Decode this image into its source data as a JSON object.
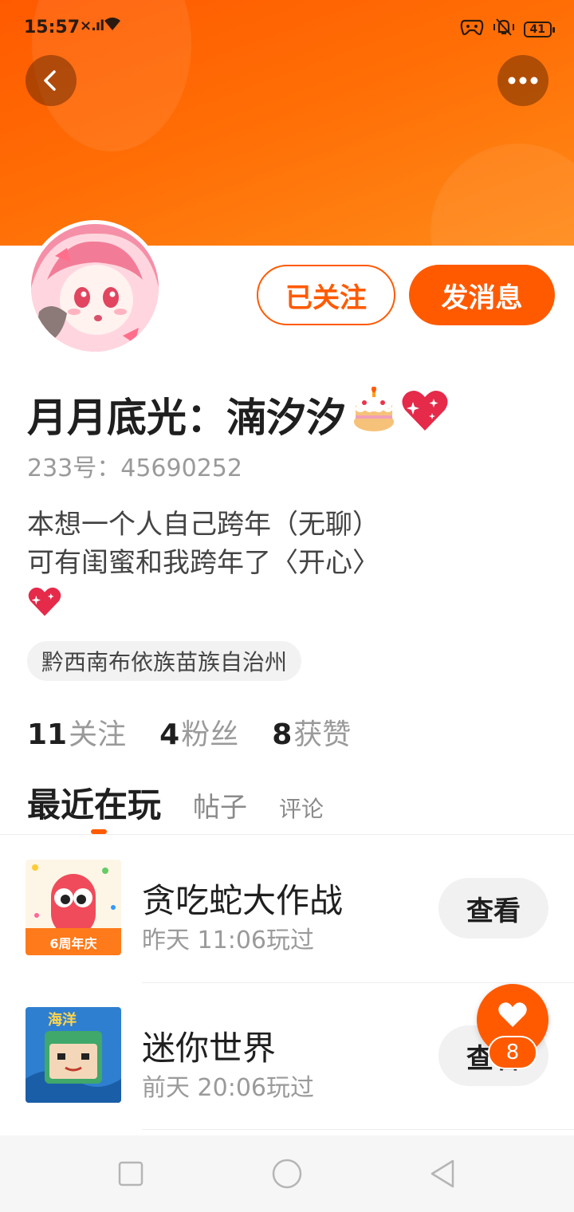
{
  "status_bar": {
    "time": "15:57",
    "signal": "×.ıl",
    "battery": "41"
  },
  "header": {
    "back_icon": "chevron-left-icon",
    "more_icon": "more-dots-icon",
    "colors": {
      "banner": "#ff6a00",
      "accent": "#ff5a00"
    }
  },
  "profile": {
    "name": "月月底光：湳汐汐",
    "name_emojis": [
      "🎂",
      "💖"
    ],
    "uid": "233号：45690252",
    "bio_lines": [
      "本想一个人自己跨年（无聊）",
      "可有闺蜜和我跨年了〈开心〉"
    ],
    "bio_emoji": "💖",
    "location": "黔西南布依族苗族自治州"
  },
  "actions": {
    "follow_label": "已关注",
    "message_label": "发消息"
  },
  "stats": [
    {
      "num": "11",
      "label": "关注"
    },
    {
      "num": "4",
      "label": "粉丝"
    },
    {
      "num": "8",
      "label": "获赞"
    }
  ],
  "tabs": [
    {
      "label": "最近在玩",
      "active": true
    },
    {
      "label": "帖子",
      "active": false
    },
    {
      "label": "评论",
      "active": false
    }
  ],
  "games": [
    {
      "title": "贪吃蛇大作战",
      "time": "昨天 11:06玩过",
      "button": "查看",
      "icon_badge": "6周年庆"
    },
    {
      "title": "迷你世界",
      "time": "前天 20:06玩过",
      "button": "查看",
      "icon_badge": "海洋"
    }
  ],
  "fab": {
    "icon": "heart-icon",
    "count": "8"
  },
  "navbar": {
    "icons": [
      "square-icon",
      "circle-icon",
      "triangle-back-icon"
    ]
  }
}
